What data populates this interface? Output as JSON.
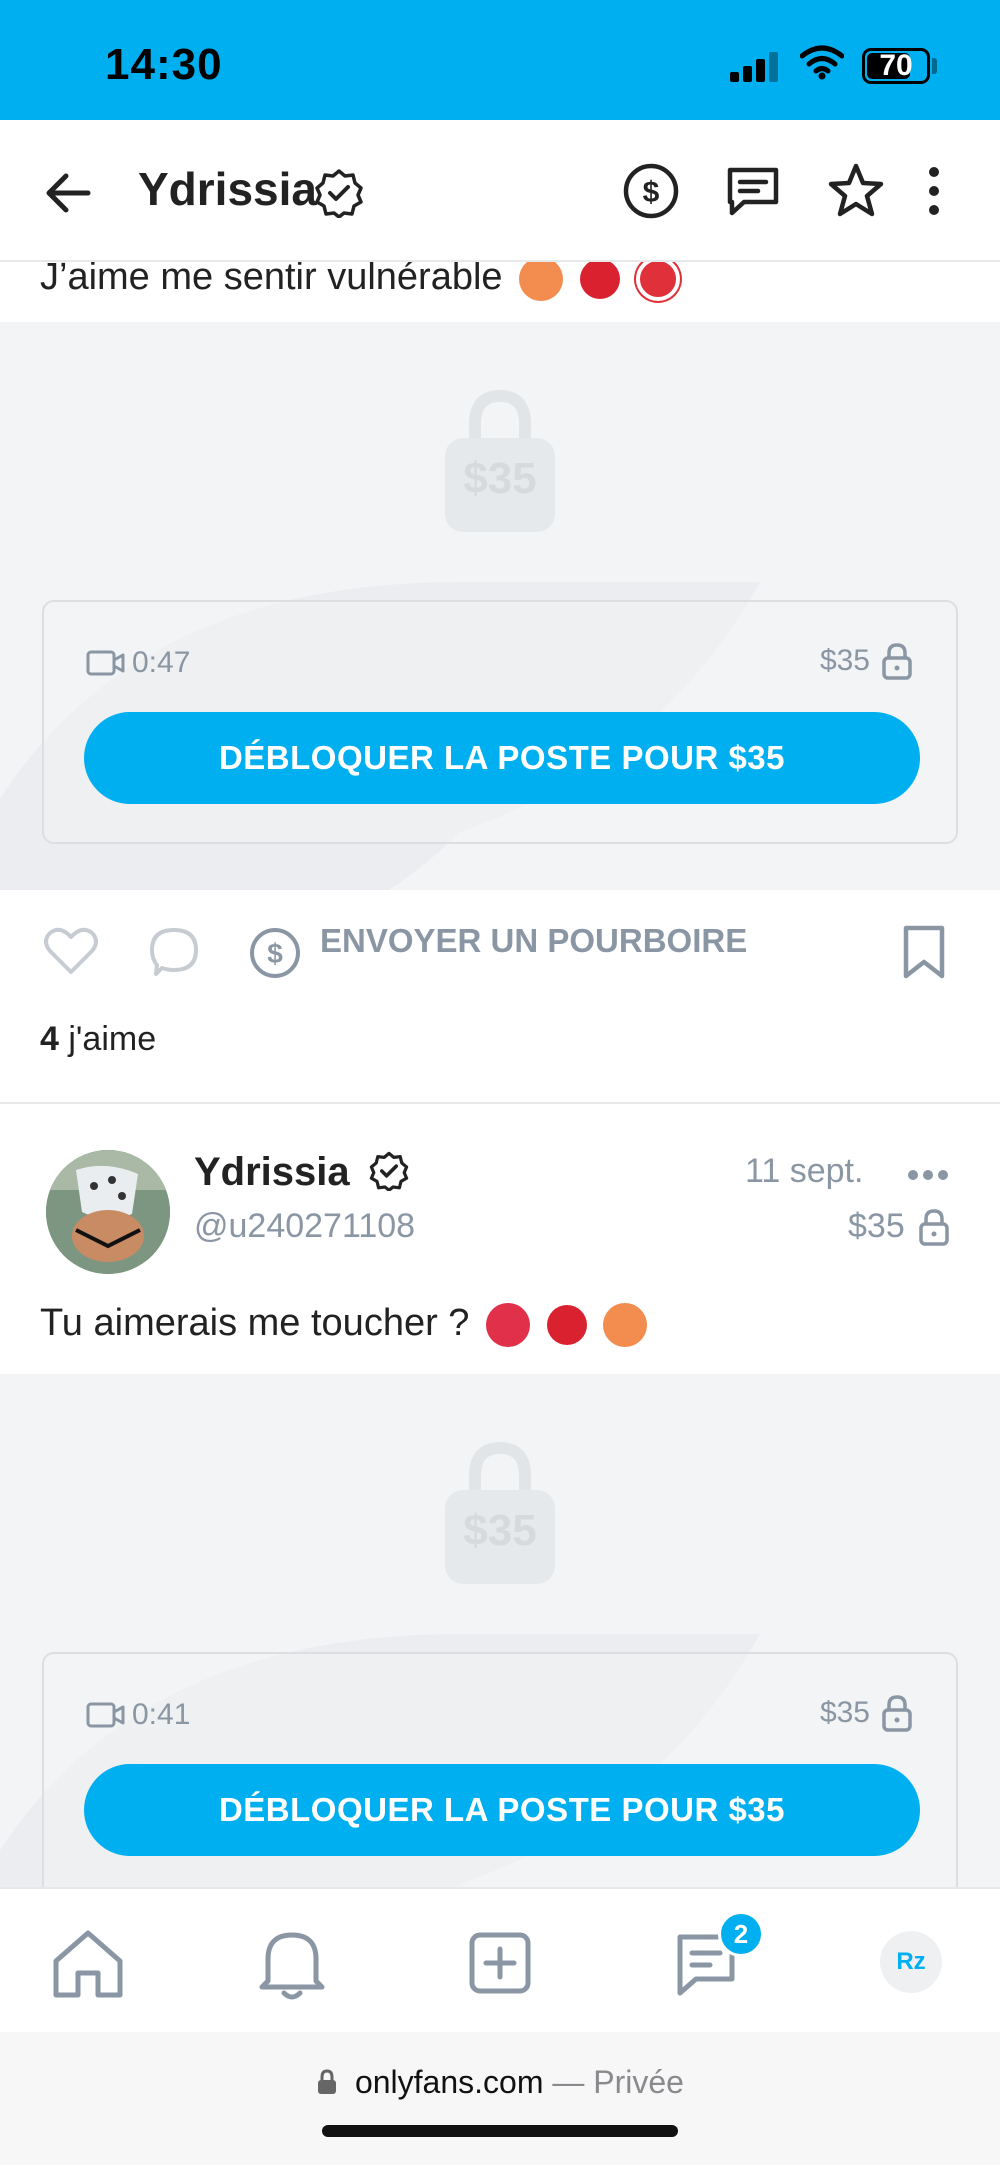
{
  "status_bar": {
    "time": "14:30",
    "battery": "70"
  },
  "header": {
    "title": "Ydrissia"
  },
  "post1": {
    "caption": "J’aime me sentir vulnérable",
    "watermark_price": "$35",
    "duration": "0:47",
    "price": "$35",
    "unlock_label": "DÉBLOQUER LA POSTE POUR $35",
    "tip_label": "ENVOYER UN POURBOIRE",
    "likes_count": "4",
    "likes_label": " j'aime"
  },
  "post2": {
    "author_name": "Ydrissia",
    "handle": "@u240271108",
    "date": "11 sept.",
    "price_label": "$35",
    "caption": "Tu aimerais me toucher ?",
    "watermark_price": "$35",
    "duration": "0:41",
    "price": "$35",
    "unlock_label": "DÉBLOQUER LA POSTE POUR $35"
  },
  "tab_bar": {
    "messages_badge": "2",
    "profile_initials": "Rz"
  },
  "browser": {
    "domain": "onlyfans.com",
    "separator": " — ",
    "mode": "Privée"
  },
  "colors": {
    "accent": "#00aff0",
    "muted": "#8a96a3",
    "locked_bg": "#f2f4f6"
  },
  "icons": [
    "back-arrow-icon",
    "verified-icon",
    "tip-dollar-icon",
    "message-icon",
    "star-icon",
    "more-vertical-icon",
    "video-icon",
    "lock-icon",
    "heart-icon",
    "comment-icon",
    "bookmark-icon",
    "home-icon",
    "bell-icon",
    "add-post-icon"
  ]
}
